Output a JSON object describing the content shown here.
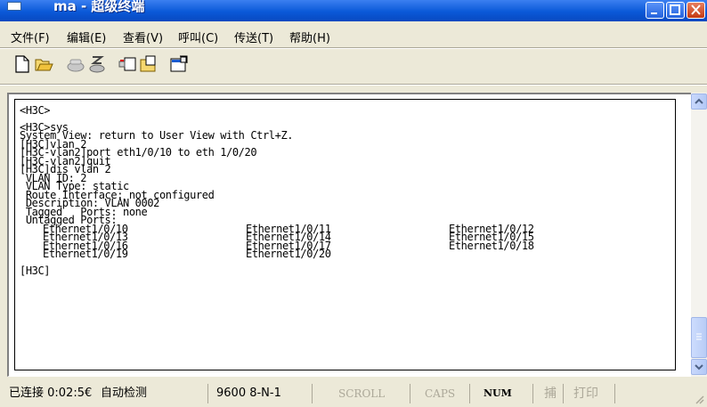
{
  "window": {
    "title": "ma - 超级终端"
  },
  "menu": {
    "items": [
      {
        "label": "文件(F)"
      },
      {
        "label": "编辑(E)"
      },
      {
        "label": "查看(V)"
      },
      {
        "label": "呼叫(C)"
      },
      {
        "label": "传送(T)"
      },
      {
        "label": "帮助(H)"
      }
    ]
  },
  "toolbar": {
    "icons": [
      "new-connection-icon",
      "open-icon",
      "call-icon",
      "disconnect-icon",
      "send-icon",
      "receive-icon",
      "properties-icon"
    ]
  },
  "terminal": {
    "lines": [
      "<H3C>",
      "<H3C>sys",
      "System View: return to User View with Ctrl+Z.",
      "[H3C]vlan 2",
      "[H3C-vlan2]port eth1/0/10 to eth 1/0/20",
      "[H3C-vlan2]quit",
      "[H3C]dis vlan 2",
      " VLAN ID: 2",
      " VLAN Type: static",
      " Route Interface: not configured",
      " Description: VLAN 0002",
      " Tagged   Ports: none",
      " Untagged Ports:"
    ],
    "ports": [
      [
        "Ethernet1/0/10",
        "Ethernet1/0/11",
        "Ethernet1/0/12"
      ],
      [
        "Ethernet1/0/13",
        "Ethernet1/0/14",
        "Ethernet1/0/15"
      ],
      [
        "Ethernet1/0/16",
        "Ethernet1/0/17",
        "Ethernet1/0/18"
      ],
      [
        "Ethernet1/0/19",
        "Ethernet1/0/20",
        ""
      ]
    ],
    "prompt": "[H3C]"
  },
  "statusbar": {
    "connected": "已连接 0:02:5€",
    "detect": "自动检测",
    "baud": "9600 8-N-1",
    "scroll": "SCROLL",
    "caps": "CAPS",
    "num": "NUM",
    "capture": "捕",
    "print": "打印"
  },
  "colors": {
    "titlebar": "#0a59d8",
    "face": "#ece9d8",
    "terminal_bg": "#ffffff"
  }
}
